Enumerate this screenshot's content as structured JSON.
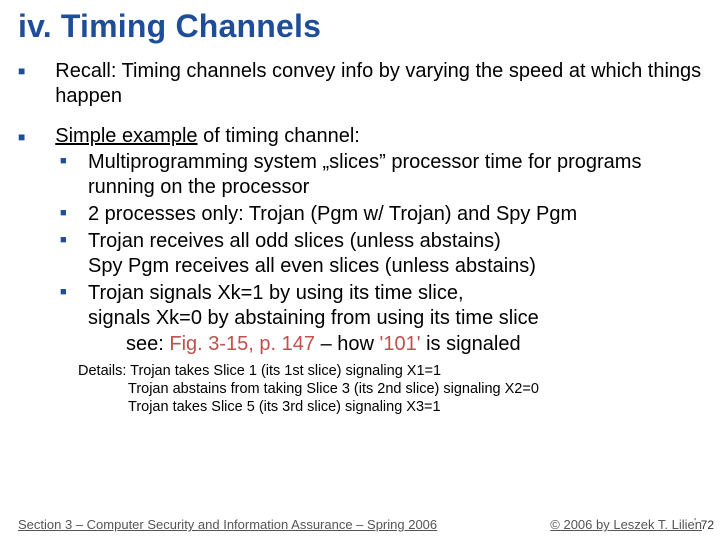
{
  "title": "iv. Timing Channels",
  "p1": "Recall:  Timing channels convey info by varying the speed at which things happen",
  "ex_lead": "Simple example",
  "ex_rest": " of timing channel:",
  "sub": [
    "Multiprogramming system „slices” processor time for programs running on the processor",
    "2 processes only: Trojan (Pgm w/ Trojan) and Spy Pgm",
    "Trojan receives all odd slices (unless abstains)\nSpy Pgm receives all even slices (unless abstains)",
    "Trojan signals Xk=1 by using its time slice,\nsignals Xk=0 by abstaining from using its time slice"
  ],
  "see_a": "see: ",
  "see_b": "Fig. 3-15, p. 147",
  "see_c": " – how ",
  "see_d": "'101'",
  "see_e": " is signaled",
  "details_lead": "Details:  ",
  "details_l1": "Trojan takes Slice 1 (its 1st slice) signaling X1=1",
  "details_l2": "Trojan abstains from taking Slice 3 (its 2nd slice) signaling X2=0",
  "details_l3": "Trojan takes Slice 5 (its 3rd slice) signaling X3=1",
  "footer_left": "Section 3 – Computer Security and Information Assurance – Spring 2006",
  "footer_right": "© 2006 by Leszek T. Lilien",
  "page_num": "72",
  "tick": "'"
}
